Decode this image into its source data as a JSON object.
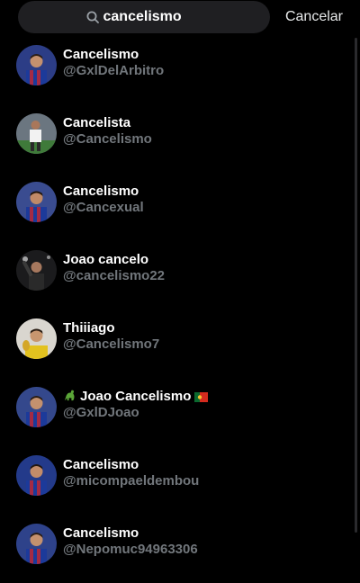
{
  "search": {
    "value": "cancelismo",
    "cancel_label": "Cancelar"
  },
  "results": [
    {
      "name": "Cancelismo",
      "handle": "@GxlDelArbitro",
      "avatar": "barca-player"
    },
    {
      "name": "Cancelista",
      "handle": "@Cancelismo",
      "avatar": "stadium-player"
    },
    {
      "name": "Cancelismo",
      "handle": "@Cancexual",
      "avatar": "barca-player"
    },
    {
      "name": "Joao cancelo",
      "handle": "@cancelismo22",
      "avatar": "dark-celebration"
    },
    {
      "name": "Thiiiago",
      "handle": "@Cancelismo7",
      "avatar": "trophy-player"
    },
    {
      "name": "Joao Cancelismo",
      "handle": "@GxlDJoao",
      "avatar": "barca-player",
      "prefix_icon": "dinosaur-icon",
      "suffix_icon": "portugal-flag-icon"
    },
    {
      "name": "Cancelismo",
      "handle": "@micompaeldembou",
      "avatar": "barca-player"
    },
    {
      "name": "Cancelismo",
      "handle": "@Nepomuc94963306",
      "avatar": "barca-player"
    }
  ]
}
